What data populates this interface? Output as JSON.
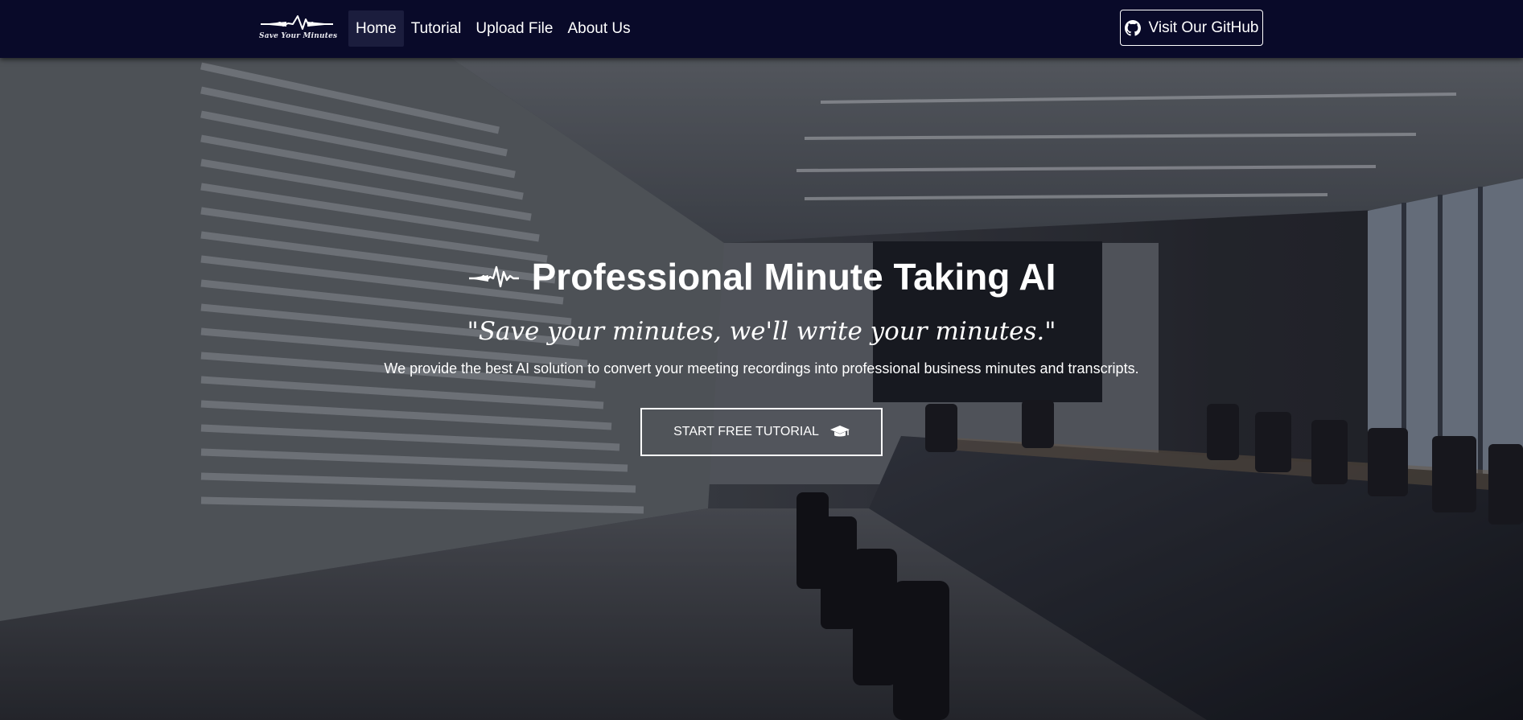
{
  "navbar": {
    "brand_text": "Save Your Minutes",
    "links": [
      {
        "label": "Home",
        "active": true
      },
      {
        "label": "Tutorial",
        "active": false
      },
      {
        "label": "Upload File",
        "active": false
      },
      {
        "label": "About Us",
        "active": false
      }
    ],
    "github_label": "Visit Our GitHub",
    "github_icon": "github-icon"
  },
  "hero": {
    "title": "Professional Minute Taking AI",
    "title_icon": "soundwave-icon",
    "quote": "\"Save your minutes, we'll write your minutes.\"",
    "description": "We provide the best AI solution to convert your meeting recordings into professional business minutes and transcripts.",
    "cta_label": "START FREE TUTORIAL",
    "cta_icon": "graduation-cap-icon",
    "background": "conference-room-photo"
  },
  "colors": {
    "navbar_bg": "#090a29",
    "active_link_bg": "#1b1d3d",
    "text": "#ffffff"
  }
}
